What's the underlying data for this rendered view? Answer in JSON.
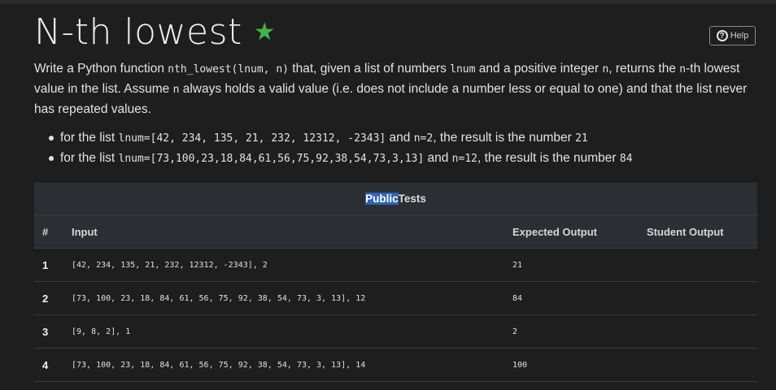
{
  "page": {
    "title": "N-th lowest",
    "star": "★",
    "help_label": "Help",
    "help_icon": "?"
  },
  "description": {
    "t1": "Write a Python function ",
    "c1": "nth_lowest(lnum, n)",
    "t2": " that, given a list of numbers ",
    "c2": "lnum",
    "t3": " and a positive integer ",
    "c3": "n",
    "t4": ", returns the ",
    "c4": "n",
    "t5": "-th lowest value in the list. Assume ",
    "c5": "n",
    "t6": " always holds a valid value (i.e. does not include a number less or equal to one) and that the list never has repeated values."
  },
  "examples": [
    {
      "a": "for the list ",
      "b": "lnum=[42, 234, 135, 21, 232, 12312, -2343]",
      "c": " and ",
      "d": "n=2",
      "e": ", the result is the number ",
      "f": "21"
    },
    {
      "a": "for the list ",
      "b": "lnum=[73,100,23,18,84,61,56,75,92,38,54,73,3,13]",
      "c": " and ",
      "d": "n=12",
      "e": ", the result is the number ",
      "f": "84"
    }
  ],
  "tests": {
    "heading_selected": "Public",
    "heading_rest": " Tests",
    "columns": {
      "num": "#",
      "input": "Input",
      "expected": "Expected Output",
      "student": "Student Output"
    },
    "rows": [
      {
        "num": "1",
        "input": "[42, 234, 135, 21, 232, 12312, -2343], 2",
        "expected": "21",
        "student": ""
      },
      {
        "num": "2",
        "input": "[73, 100, 23, 18, 84, 61, 56, 75, 92, 38, 54, 73, 3, 13], 12",
        "expected": "84",
        "student": ""
      },
      {
        "num": "3",
        "input": "[9, 8, 2], 1",
        "expected": "2",
        "student": ""
      },
      {
        "num": "4",
        "input": "[73, 100, 23, 18, 84, 61, 56, 75, 92, 38, 54, 73, 3, 13], 14",
        "expected": "100",
        "student": ""
      }
    ]
  },
  "colors": {
    "background": "#1e1e1e",
    "star": "#43b247",
    "selection": "#2f62b8"
  }
}
